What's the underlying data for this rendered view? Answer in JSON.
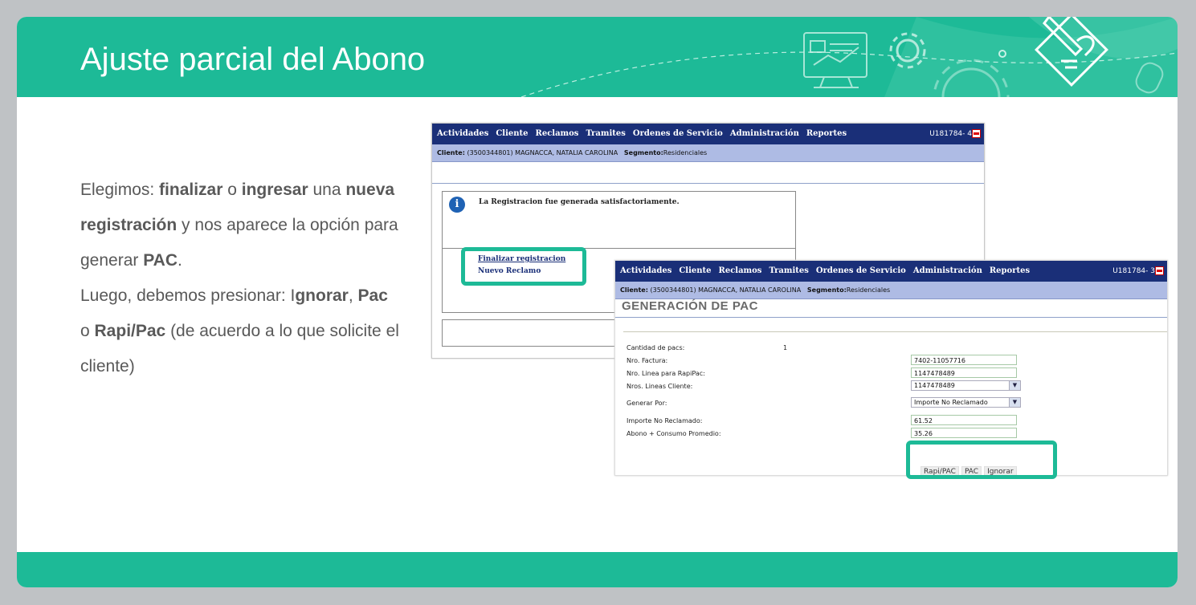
{
  "slide": {
    "title": "Ajuste parcial del Abono",
    "body": {
      "p1_a": "Elegimos: ",
      "p1_b": "finalizar",
      "p1_c": " o ",
      "p1_d": "ingresar",
      "p1_e": " una ",
      "p1_f": "nueva registración",
      "p1_g": " y nos aparece la opción para generar ",
      "p1_h": "PAC",
      "p1_i": ".",
      "p2_a": "Luego, debemos presionar: I",
      "p2_b": "gnorar",
      "p2_c": ", ",
      "p2_d": "Pac",
      "p2_e": " o ",
      "p2_f": "Rapi/Pac",
      "p2_g": " (de acuerdo a lo que solicite el cliente)"
    }
  },
  "app_nav": {
    "items": [
      "Actividades",
      "Cliente",
      "Reclamos",
      "Tramites",
      "Ordenes de Servicio",
      "Administración",
      "Reportes"
    ],
    "user1": "U181784- 4",
    "user2": "U181784- 3"
  },
  "client_bar": {
    "client_label": "Cliente:",
    "client_value": "(3500344801) MAGNACCA, NATALIA CAROLINA",
    "segment_label": "Segmento:",
    "segment_value": "Residenciales"
  },
  "screen1": {
    "message": "La Registracion fue generada satisfactoriamente.",
    "link_finalize": "Finalizar registracion",
    "link_new": "Nuevo Reclamo"
  },
  "screen2": {
    "title": "GENERACIÓN DE PAC",
    "fields": {
      "count_label": "Cantidad de pacs:",
      "count_value": "1",
      "invoice_label": "Nro. Factura:",
      "invoice_value": "7402-11057716",
      "rapipac_line_label": "Nro. Linea para RapiPac:",
      "rapipac_line_value": "1147478489",
      "client_lines_label": "Nros. Lineas Cliente:",
      "client_lines_value": "1147478489",
      "generate_by_label": "Generar Por:",
      "generate_by_value": "Importe No Reclamado",
      "unclaimed_label": "Importe No Reclamado:",
      "unclaimed_value": "61.52",
      "avg_label": "Abono + Consumo Promedio:",
      "avg_value": "35.26"
    },
    "buttons": {
      "rapipac": "Rapi/PAC",
      "pac": "PAC",
      "ignore": "Ignorar"
    }
  },
  "colors": {
    "accent": "#1dba97",
    "nav_bg": "#1a2f78",
    "subbar_bg": "#aebbe4"
  }
}
